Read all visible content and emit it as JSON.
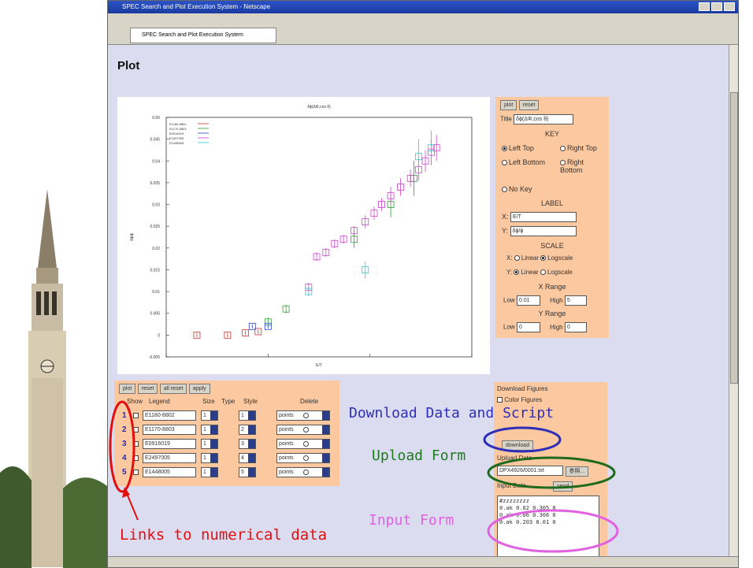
{
  "window": {
    "title": "SPEC Search and Plot Execution System - Netscape",
    "tab_title": "SPEC Search and Plot Execution System"
  },
  "page": {
    "heading": "Plot"
  },
  "plot_controls": {
    "plot_button": "plot",
    "reset_button": "reset",
    "title_label": "Title",
    "title_value": "δϕ(ΔΦ,cos θ)",
    "key_header": "KEY",
    "key_options": [
      "Left Top",
      "Right Top",
      "Left Bottom",
      "Right Bottom",
      "No Key"
    ],
    "key_selected": "Left Top",
    "label_header": "LABEL",
    "x_label": "X:",
    "x_value": "E/T",
    "y_label": "Y:",
    "y_value": "δϕ/ϕ",
    "scale_header": "SCALE",
    "scale_x_label": "X:",
    "scale_y_label": "Y:",
    "scale_linear": "Linear",
    "scale_log": "Logscale",
    "scale_x_selected": "Logscale",
    "scale_y_selected": "Linear",
    "xrange_header": "X Range",
    "yrange_header": "Y Range",
    "low_label": "Low",
    "high_label": "High",
    "x_low": "0.01",
    "x_high": "5",
    "y_low": "0",
    "y_high": "0"
  },
  "series_table": {
    "buttons": [
      "plot",
      "reset",
      "all reset",
      "apply"
    ],
    "headers": [
      "Show",
      "Legend",
      "Size",
      "Type",
      "Style",
      "Delete"
    ],
    "rows": [
      {
        "link": "1",
        "legend": "E1180-8802",
        "size": "1",
        "type": "1",
        "style": "points"
      },
      {
        "link": "2",
        "legend": "E1170-8803",
        "size": "1",
        "type": "2",
        "style": "points"
      },
      {
        "link": "3",
        "legend": "E0916019",
        "size": "1",
        "type": "3",
        "style": "points"
      },
      {
        "link": "4",
        "legend": "E2497005",
        "size": "1",
        "type": "4",
        "style": "points"
      },
      {
        "link": "5",
        "legend": "E1448005",
        "size": "1",
        "type": "5",
        "style": "points"
      }
    ]
  },
  "download_panel": {
    "header": "Download Figures",
    "color_option": "Color Figures",
    "download_button": "download",
    "upload_header": "Upload Data",
    "upload_field": "DPX4926/0001.txt",
    "upload_button": "参照...",
    "input_header": "Input Data",
    "input_button": "send",
    "input_text": "#zzzzzzzz\n0.ak 0.02 0.305 0\n0.ak 0.06 0.306 0\n0.ak 0.203 0.01 0"
  },
  "annotations": {
    "download": "Download Data and Script",
    "upload": "Upload Form",
    "input": "Input Form",
    "links": "Links to numerical data"
  },
  "chart_data": {
    "type": "scatter",
    "title": "δϕ(ΔΦ,cos θ)",
    "xlabel": "E/T",
    "ylabel": "δϕ/ϕ",
    "xscale": "log",
    "xlim": [
      0.01,
      10
    ],
    "ylim": [
      -0.005,
      0.05
    ],
    "yticks": [
      -0.005,
      0,
      0.005,
      0.01,
      0.015,
      0.02,
      0.025,
      0.03,
      0.035,
      0.04,
      0.045,
      0.05
    ],
    "legend_position": "top-left",
    "series": [
      {
        "name": "E1180-8802",
        "color": "#d0302c",
        "x": [
          0.02,
          0.04,
          0.06,
          0.08
        ],
        "y": [
          0,
          0,
          0.0005,
          0.0008
        ],
        "err": [
          0.0005,
          0.0005,
          0.0005,
          0.0005
        ]
      },
      {
        "name": "E1170-8803",
        "color": "#2ca02c",
        "x": [
          0.1,
          0.15,
          0.7,
          1.6,
          2.7
        ],
        "y": [
          0.003,
          0.006,
          0.022,
          0.03,
          0.036
        ],
        "err": [
          0.001,
          0.001,
          0.002,
          0.003,
          0.004
        ]
      },
      {
        "name": "E0916019",
        "color": "#2c40c8",
        "x": [
          0.07,
          0.1
        ],
        "y": [
          0.002,
          0.002
        ],
        "err": [
          0.0005,
          0.0005
        ]
      },
      {
        "name": "E2497005",
        "color": "#cc44cc",
        "x": [
          0.25,
          0.3,
          0.37,
          0.45,
          0.55,
          0.7,
          0.9,
          1.1,
          1.3,
          1.6,
          2,
          2.5,
          3,
          3.5,
          4,
          4.5
        ],
        "y": [
          0.011,
          0.018,
          0.019,
          0.021,
          0.022,
          0.024,
          0.026,
          0.028,
          0.03,
          0.032,
          0.034,
          0.036,
          0.038,
          0.04,
          0.042,
          0.043
        ],
        "err": [
          0.001,
          0.001,
          0.001,
          0.001,
          0.001,
          0.001,
          0.0015,
          0.0015,
          0.0015,
          0.002,
          0.002,
          0.002,
          0.0025,
          0.0025,
          0.003,
          0.003
        ]
      },
      {
        "name": "E1448005",
        "color": "#2cc8c8",
        "x": [
          0.25,
          0.9,
          3,
          4
        ],
        "y": [
          0.01,
          0.015,
          0.041,
          0.043
        ],
        "err": [
          0.001,
          0.002,
          0.004,
          0.004
        ]
      }
    ]
  }
}
